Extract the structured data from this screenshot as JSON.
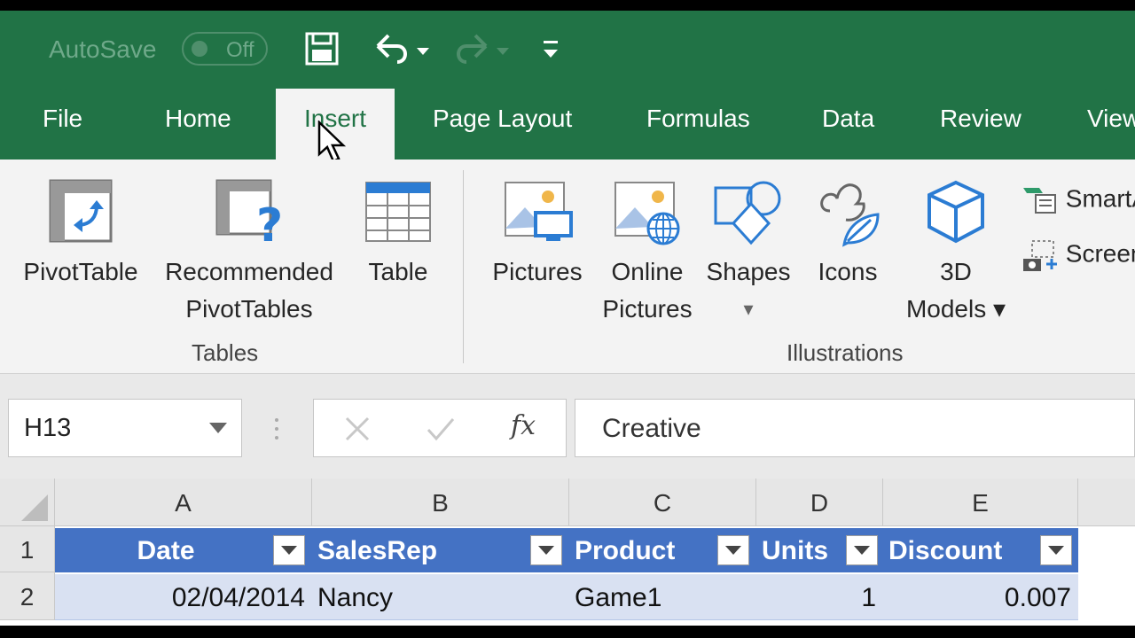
{
  "quick_access": {
    "autosave_label": "AutoSave",
    "autosave_state": "Off",
    "icons": [
      "save-icon",
      "undo-icon",
      "redo-icon",
      "customize-icon"
    ]
  },
  "tabs": [
    {
      "label": "File"
    },
    {
      "label": "Home"
    },
    {
      "label": "Insert",
      "active": true
    },
    {
      "label": "Page Layout"
    },
    {
      "label": "Formulas"
    },
    {
      "label": "Data"
    },
    {
      "label": "Review"
    },
    {
      "label": "View"
    }
  ],
  "ribbon": {
    "groups": [
      {
        "label": "Tables",
        "buttons": [
          {
            "line1": "PivotTable",
            "line2": ""
          },
          {
            "line1": "Recommended",
            "line2": "PivotTables"
          },
          {
            "line1": "Table",
            "line2": ""
          }
        ]
      },
      {
        "label": "Illustrations",
        "buttons": [
          {
            "line1": "Pictures",
            "line2": ""
          },
          {
            "line1": "Online",
            "line2": "Pictures"
          },
          {
            "line1": "Shapes",
            "line2": "▾"
          },
          {
            "line1": "Icons",
            "line2": ""
          },
          {
            "line1": "3D",
            "line2": "Models ▾"
          }
        ]
      }
    ],
    "small_buttons": [
      "SmartArt",
      "Screenshot"
    ]
  },
  "formula_bar": {
    "name_box": "H13",
    "fx_label": "fx",
    "content": "Creative"
  },
  "sheet": {
    "columns": [
      "A",
      "B",
      "C",
      "D",
      "E"
    ],
    "rows": [
      "1",
      "2"
    ],
    "headers": [
      "Date",
      "SalesRep",
      "Product",
      "Units",
      "Discount"
    ],
    "data": [
      [
        "02/04/2014",
        "Nancy",
        "Game1",
        "1",
        "0.007"
      ]
    ]
  },
  "colors": {
    "title_green": "#217346",
    "table_header_blue": "#4472c4",
    "table_band_blue": "#d9e1f2"
  }
}
